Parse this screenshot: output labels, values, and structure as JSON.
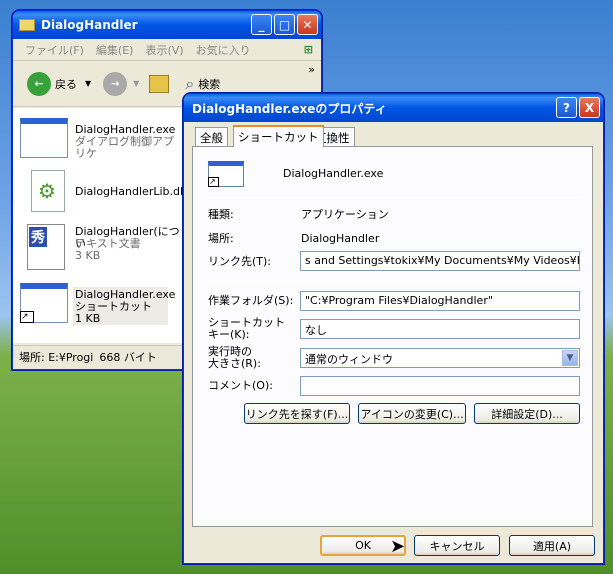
{
  "explorer": {
    "title": "DialogHandler",
    "menu": [
      "ファイル(F)",
      "編集(E)",
      "表示(V)",
      "お気に入り"
    ],
    "toolbar": {
      "back": "戻る",
      "search": "検索",
      "more": "»"
    },
    "files": [
      {
        "name": "DialogHandler.exe",
        "line2": "ダイアログ制御アプリケ",
        "line3": ""
      },
      {
        "name": "DialogHandlerLib.dll",
        "line2": "",
        "line3": ""
      },
      {
        "name": "DialogHandler(につい",
        "line2": "テキスト文書",
        "line3": "3 KB"
      },
      {
        "name": "DialogHandler.exe",
        "line2": "ショートカット",
        "line3": "1 KB"
      }
    ],
    "status": {
      "location": "場所: E:¥Progi",
      "size": "668 バイト"
    }
  },
  "dialog": {
    "title": "DialogHandler.exeのプロパティ",
    "help": "?",
    "close": "X",
    "tabs": [
      "全般",
      "ショートカット",
      "互換性"
    ],
    "file_name": "DialogHandler.exe",
    "type_label": "種類:",
    "type_value": "アプリケーション",
    "location_label": "場所:",
    "location_value": "DialogHandler",
    "target_label": "リンク先(T):",
    "target_value": "s and Settings¥tokix¥My Documents¥My Videos¥PV\"",
    "workdir_label": "作業フォルダ(S):",
    "workdir_value": "\"C:¥Program Files¥DialogHandler\"",
    "shortcut_label1": "ショートカット",
    "shortcut_label2": "キー(K):",
    "shortcut_value": "なし",
    "size_label1": "実行時の",
    "size_label2": "大きさ(R):",
    "size_value": "通常のウィンドウ",
    "comment_label": "コメント(O):",
    "comment_value": "",
    "find_target": "リンク先を探す(F)...",
    "change_icon": "アイコンの変更(C)...",
    "advanced": "詳細設定(D)...",
    "ok": "OK",
    "cancel": "キャンセル",
    "apply": "適用(A)"
  }
}
